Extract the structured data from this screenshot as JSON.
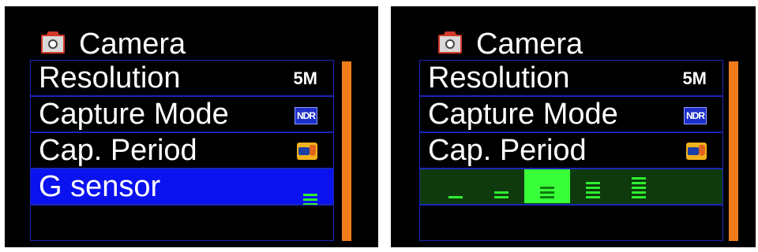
{
  "left_screen": {
    "title": "Camera",
    "icon": "camera-icon",
    "items": [
      {
        "label": "Resolution",
        "value": "5M"
      },
      {
        "label": "Capture Mode",
        "value": "NDR"
      },
      {
        "label": "Cap. Period",
        "value_icon": "capture-period-icon"
      },
      {
        "label": "G sensor",
        "value_icon": "g-sensor-level-icon",
        "selected": true
      }
    ]
  },
  "right_screen": {
    "title": "Camera",
    "icon": "camera-icon",
    "items": [
      {
        "label": "Resolution",
        "value": "5M"
      },
      {
        "label": "Capture Mode",
        "value": "NDR"
      },
      {
        "label": "Cap. Period",
        "value_icon": "capture-period-icon"
      }
    ],
    "g_sensor_levels": [
      1,
      2,
      3,
      4,
      5
    ],
    "g_sensor_selected_level": 3
  },
  "colors": {
    "selection_blue": "#0a12f0",
    "row_border": "#1a26b8",
    "scrollbar_orange": "#f07d1a",
    "level_green": "#2ef02e",
    "level_active_green": "#39ff39"
  }
}
